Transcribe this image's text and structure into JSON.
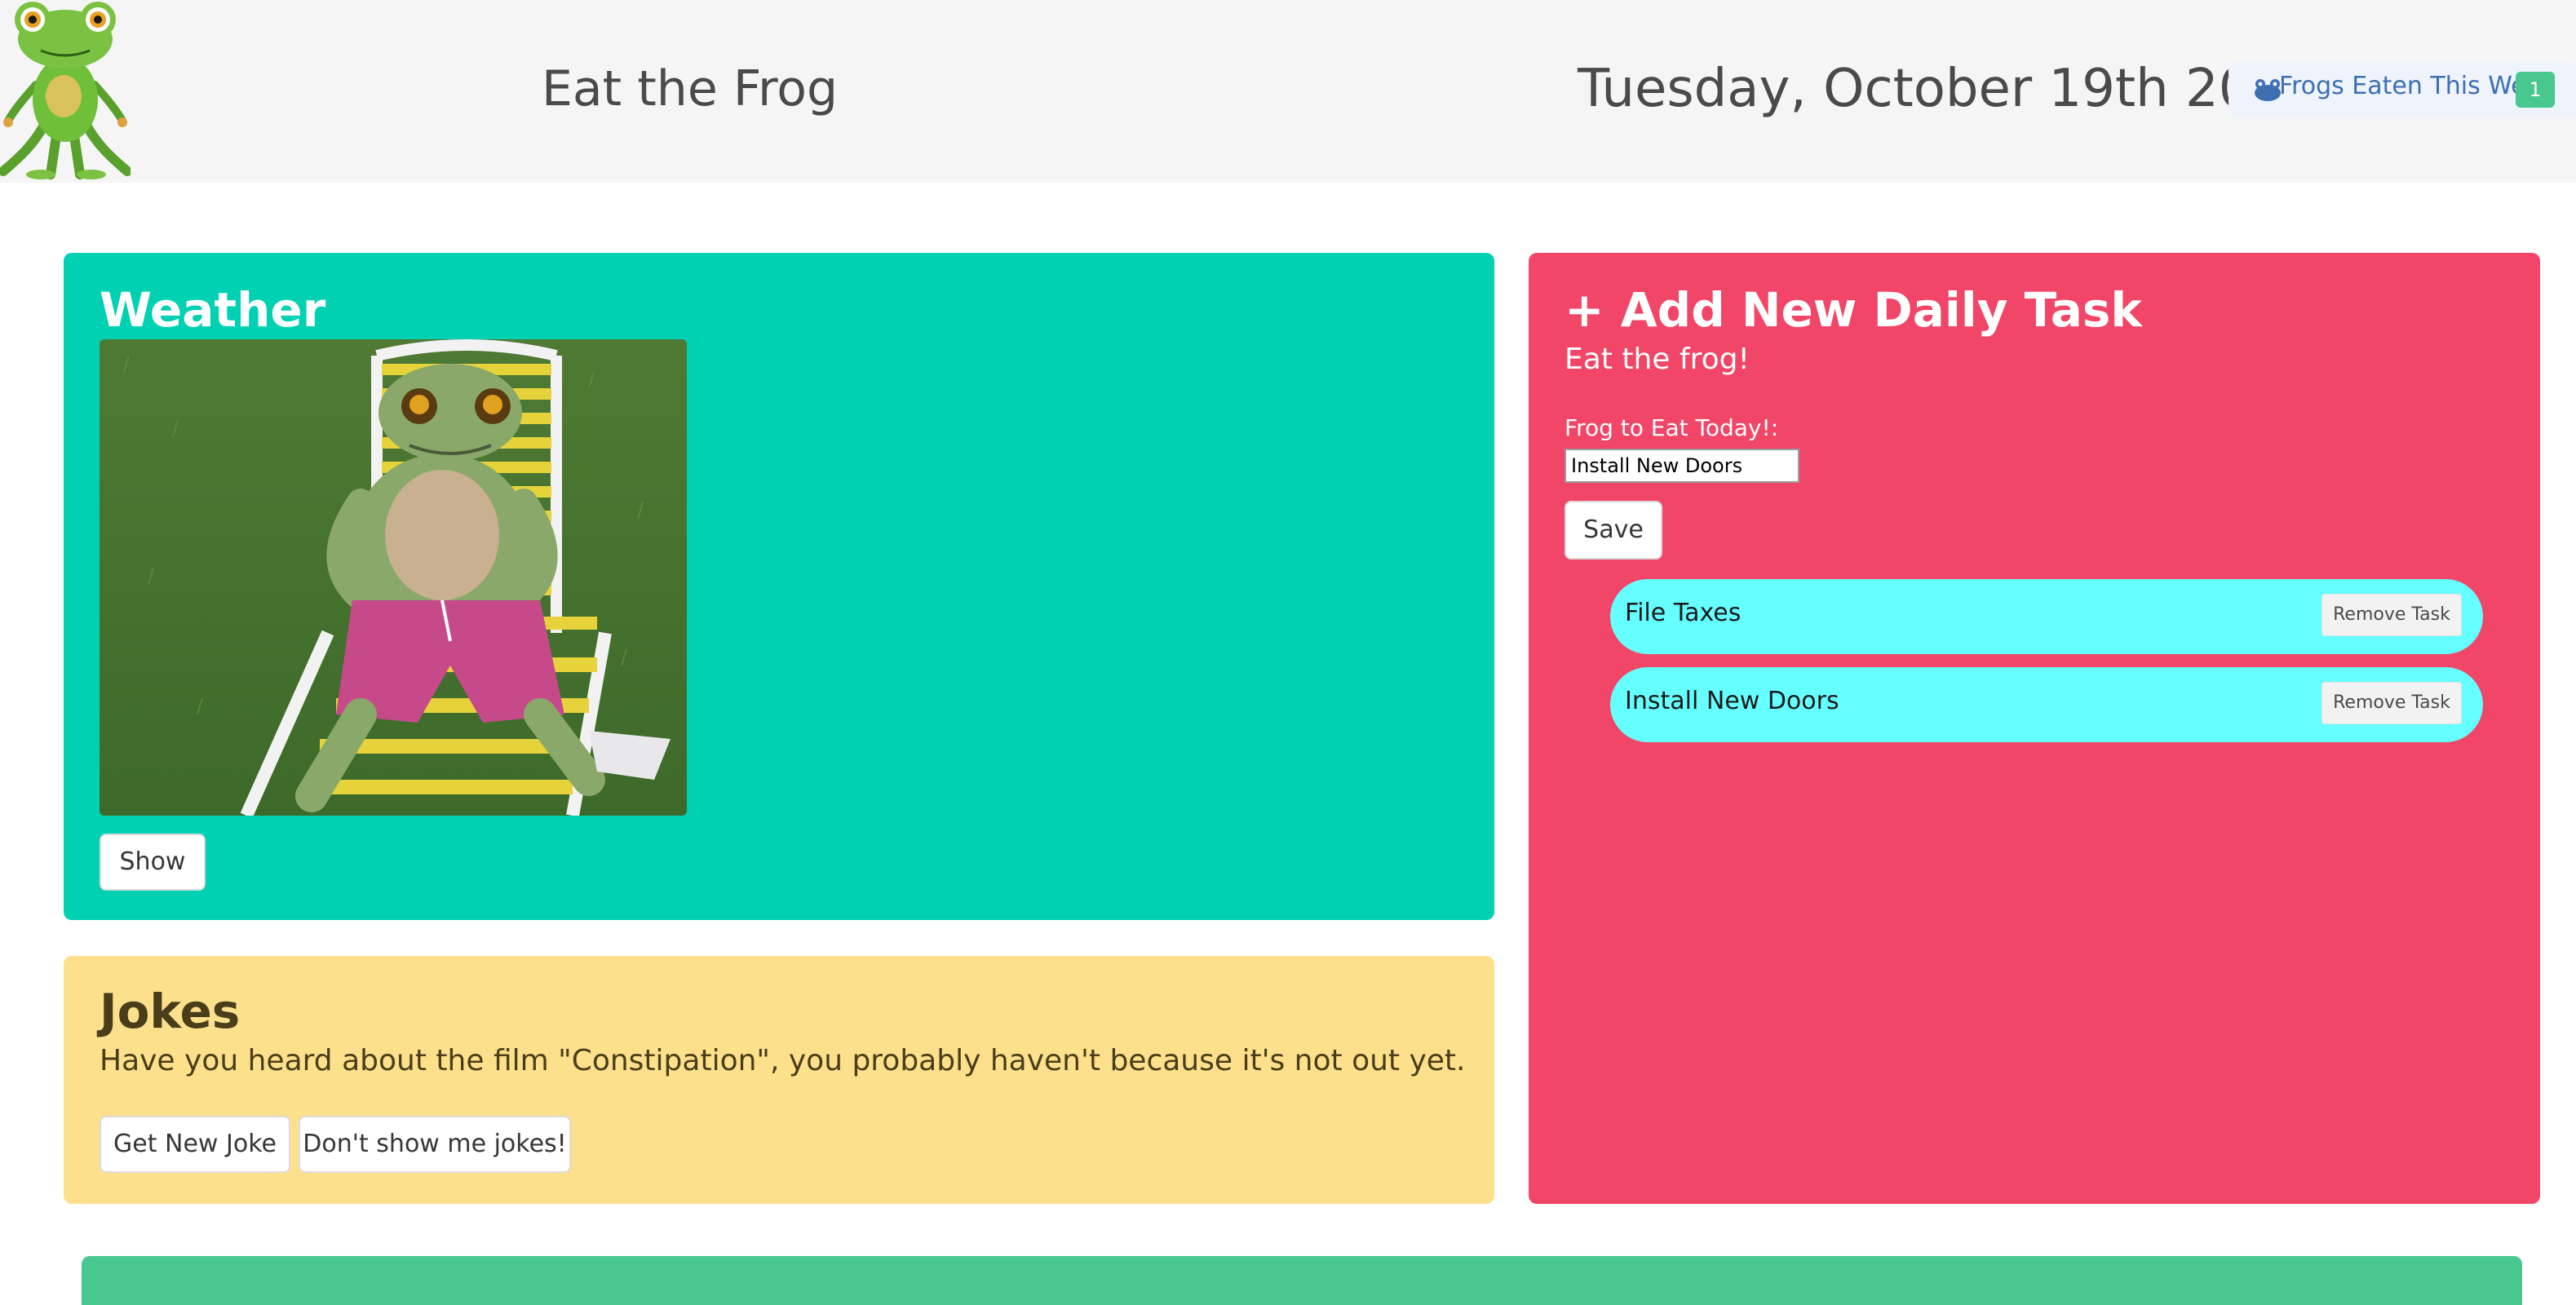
{
  "header": {
    "logo_icon": "frog-logo-icon",
    "app_title": "Eat the Frog",
    "date": "Tuesday, October 19th 2021",
    "frogs_eaten": {
      "icon": "frog-icon",
      "label": "Frogs Eaten This Week",
      "count": "1"
    }
  },
  "weather": {
    "title": "Weather",
    "image_alt": "frog relaxing on a lawn chair",
    "show_label": "Show"
  },
  "jokes": {
    "title": "Jokes",
    "text": "Have you heard about the film \"Constipation\", you probably haven't because it's not out yet.",
    "new_joke_label": "Get New Joke",
    "hide_jokes_label": "Don't show me jokes!"
  },
  "tasks": {
    "title": "+ Add New Daily Task",
    "subtitle": "Eat the frog!",
    "input_label": "Frog to Eat Today!:",
    "input_value": "Install New Doors",
    "save_label": "Save",
    "items": [
      {
        "label": "File Taxes",
        "remove_label": "Remove Task"
      },
      {
        "label": "Install New Doors",
        "remove_label": "Remove Task"
      }
    ]
  },
  "colors": {
    "weather_bg": "#00d1b2",
    "jokes_bg": "#fde08b",
    "tasks_bg": "#f14668",
    "task_item_bg": "#66ffff",
    "footer_bg": "#48c78e"
  }
}
